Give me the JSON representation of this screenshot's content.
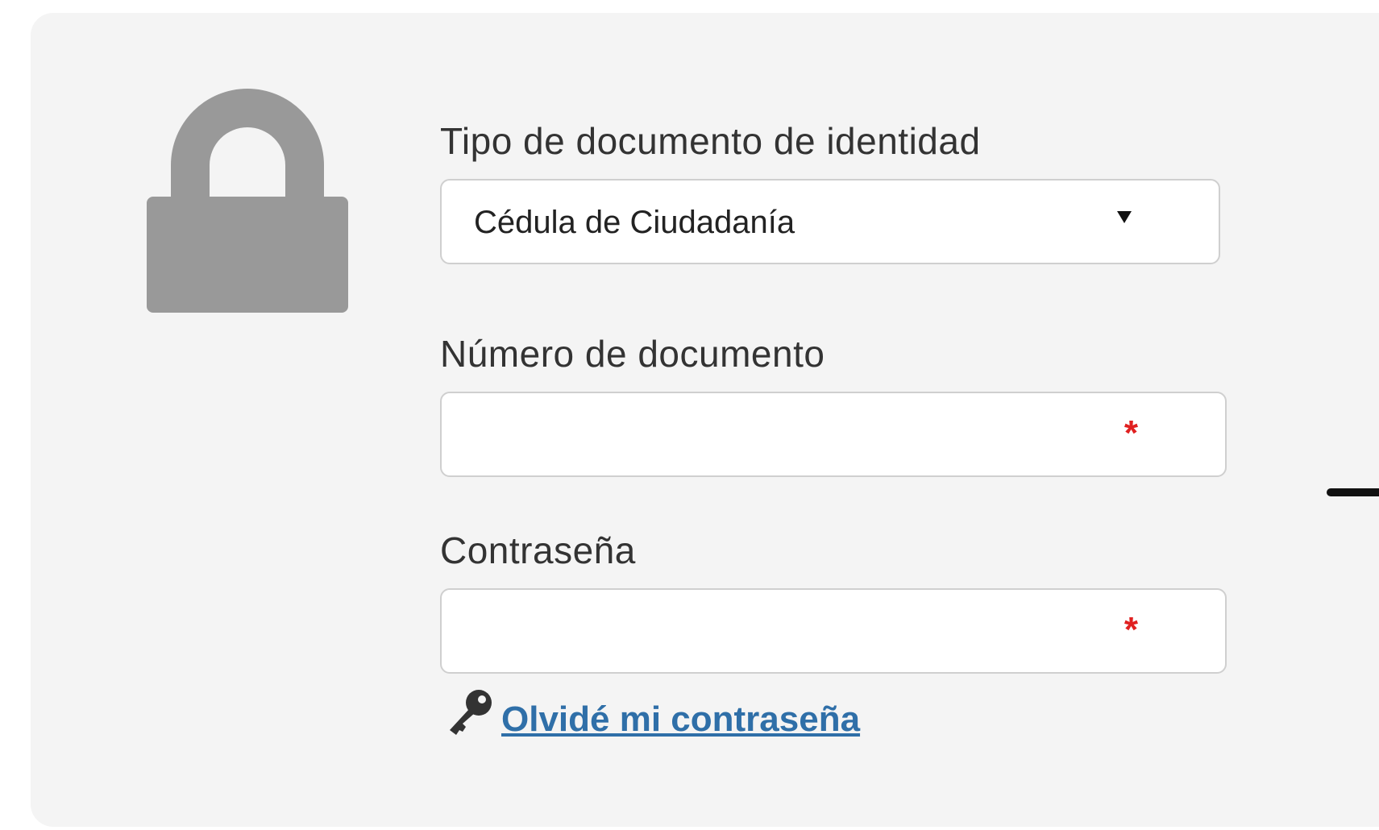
{
  "form": {
    "doc_type": {
      "label": "Tipo de documento de identidad",
      "selected": "Cédula de Ciudadanía"
    },
    "doc_number": {
      "label": "Número de documento",
      "value": "",
      "required_mark": "*"
    },
    "password": {
      "label": "Contraseña",
      "value": "",
      "required_mark": "*"
    },
    "forgot_password": {
      "label": "Olvidé mi contraseña"
    }
  },
  "icons": {
    "lock": "lock-icon",
    "key": "key-icon",
    "dropdown": "chevron-down-icon"
  },
  "colors": {
    "panel_bg": "#f4f4f4",
    "lock": "#999999",
    "required": "#e02020",
    "link": "#2f6fa8"
  }
}
